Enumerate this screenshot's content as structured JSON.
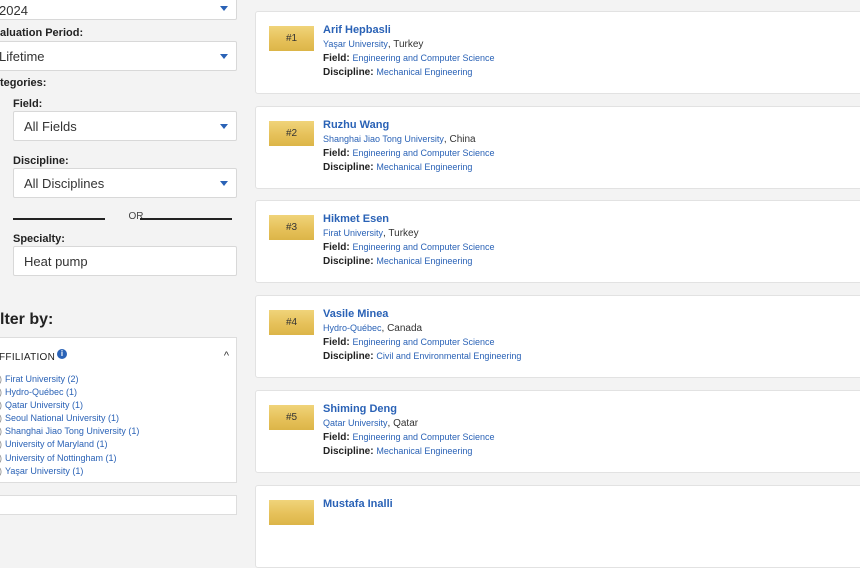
{
  "left": {
    "year": "2024",
    "evaluation_period_label": "aluation Period:",
    "evaluation_period_value": "Lifetime",
    "categories_label": "tegories:",
    "field_label": "Field:",
    "field_value": "All Fields",
    "discipline_label": "Discipline:",
    "discipline_value": "All Disciplines",
    "or_text": "OR",
    "specialty_label": "Specialty:",
    "specialty_value": "Heat pump",
    "filter_title": "lter by:",
    "affiliation_heading": "FFILIATION",
    "info_icon": "i",
    "chevron": "^",
    "affiliations": [
      "Firat University (2)",
      "Hydro-Québec (1)",
      "Qatar University (1)",
      "Seoul National University (1)",
      "Shanghai Jiao Tong University (1)",
      "University of Maryland (1)",
      "University of Nottingham (1)",
      "Yaşar University (1)"
    ]
  },
  "labels": {
    "field": "Field:",
    "discipline": "Discipline:"
  },
  "results": [
    {
      "rank": "#1",
      "name": "Arif Hepbasli",
      "university": "Yaşar University",
      "country": ", Turkey",
      "field": "Engineering and Computer Science",
      "discipline": "Mechanical Engineering"
    },
    {
      "rank": "#2",
      "name": "Ruzhu Wang",
      "university": "Shanghai Jiao Tong University",
      "country": ", China",
      "field": "Engineering and Computer Science",
      "discipline": "Mechanical Engineering"
    },
    {
      "rank": "#3",
      "name": "Hikmet Esen",
      "university": "Firat University",
      "country": ", Turkey",
      "field": "Engineering and Computer Science",
      "discipline": "Mechanical Engineering"
    },
    {
      "rank": "#4",
      "name": "Vasile Minea",
      "university": "Hydro-Québec",
      "country": ", Canada",
      "field": "Engineering and Computer Science",
      "discipline": "Civil and Environmental Engineering"
    },
    {
      "rank": "#5",
      "name": "Shiming Deng",
      "university": "Qatar University",
      "country": ", Qatar",
      "field": "Engineering and Computer Science",
      "discipline": "Mechanical Engineering"
    },
    {
      "rank": "",
      "name": "Mustafa Inalli",
      "university": "",
      "country": "",
      "field": "",
      "discipline": ""
    }
  ],
  "colors": {
    "accent": "#2a62b6",
    "rank_badge": "#e6c15a"
  }
}
